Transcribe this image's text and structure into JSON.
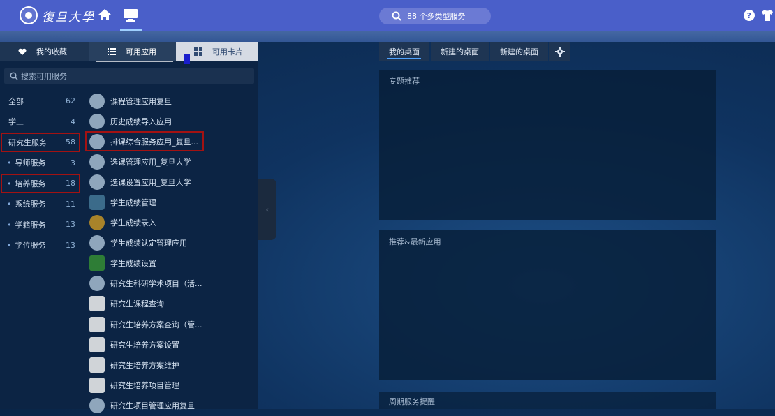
{
  "header": {
    "logo_text": "復旦大學",
    "search_label": "88 个多类型服务"
  },
  "left": {
    "tabs": [
      {
        "label": "我的收藏",
        "icon": "heart-icon"
      },
      {
        "label": "可用应用",
        "icon": "list-icon"
      },
      {
        "label": "可用卡片",
        "icon": "grid-icon"
      }
    ],
    "search_placeholder": "搜索可用服务",
    "categories": [
      {
        "name": "全部",
        "count": "62"
      },
      {
        "name": "学工",
        "count": "4"
      },
      {
        "name": "研究生服务",
        "count": "58"
      },
      {
        "name": "导师服务",
        "count": "3"
      },
      {
        "name": "培养服务",
        "count": "18"
      },
      {
        "name": "系统服务",
        "count": "11"
      },
      {
        "name": "学籍服务",
        "count": "13"
      },
      {
        "name": "学位服务",
        "count": "13"
      }
    ],
    "apps": [
      {
        "label": "课程管理应用复旦",
        "icon": "cloud-icon"
      },
      {
        "label": "历史成绩导入应用",
        "icon": "cloud-icon"
      },
      {
        "label": "排课综合服务应用_复旦...",
        "icon": "cloud-icon"
      },
      {
        "label": "选课管理应用_复旦大学",
        "icon": "cloud-icon"
      },
      {
        "label": "选课设置应用_复旦大学",
        "icon": "cloud-icon"
      },
      {
        "label": "学生成绩管理",
        "icon": "ledger-icon"
      },
      {
        "label": "学生成绩录入",
        "icon": "ledger-icon"
      },
      {
        "label": "学生成绩认定管理应用",
        "icon": "cloud-icon"
      },
      {
        "label": "学生成绩设置",
        "icon": "ledger-icon"
      },
      {
        "label": "研究生科研学术项目（活...",
        "icon": "cloud-icon"
      },
      {
        "label": "研究生课程查询",
        "icon": "grad-hat-icon"
      },
      {
        "label": "研究生培养方案查询（管...",
        "icon": "grad-hat-icon"
      },
      {
        "label": "研究生培养方案设置",
        "icon": "grad-hat-icon"
      },
      {
        "label": "研究生培养方案维护",
        "icon": "grad-hat-icon"
      },
      {
        "label": "研究生培养项目管理",
        "icon": "grad-hat-icon"
      },
      {
        "label": "研究生项目管理应用复旦",
        "icon": "cloud-icon"
      }
    ]
  },
  "desktop": {
    "tabs": [
      "我的桌面",
      "新建的桌面",
      "新建的桌面"
    ],
    "panels": [
      "专题推荐",
      "推荐&最新应用",
      "周期服务提醒"
    ]
  }
}
